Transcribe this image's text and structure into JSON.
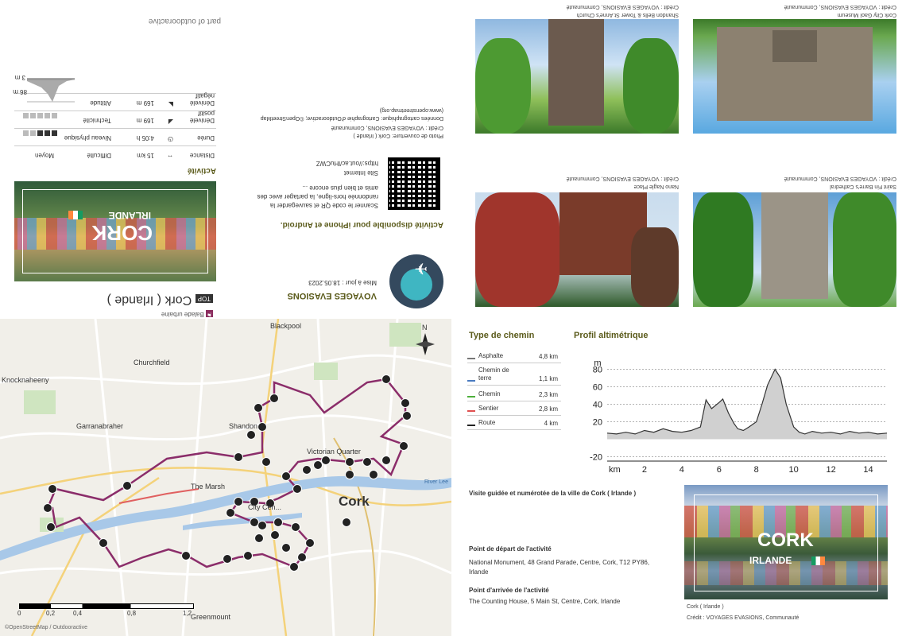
{
  "header": {
    "brand": "part of outdooractive",
    "category": "Balade urbaine",
    "top_badge": "TOP",
    "title": "Cork ( Irlande )"
  },
  "cover_card": {
    "city": "CORK",
    "country": "IRLANDE"
  },
  "activity_table": {
    "heading": "Activité",
    "rows": [
      {
        "label": "Distance",
        "icon": "distance-icon",
        "value": "15 km",
        "extra_label": "Difficulté",
        "extra_value": "Moyen"
      },
      {
        "label": "Durée",
        "icon": "clock-icon",
        "value": "4:05 h",
        "extra_label": "Niveau physique",
        "extra_value": ""
      },
      {
        "label": "Dénivelé positif",
        "icon": "ascent-icon",
        "value": "169 m",
        "extra_label": "Technicité",
        "extra_value": ""
      },
      {
        "label": "Dénivelé négatif",
        "icon": "descent-icon",
        "value": "169 m",
        "extra_label": "Altitude",
        "extra_value": ""
      }
    ],
    "physical_level": 3,
    "technical_level": 0,
    "level_max": 5,
    "altitude_max": "86 m",
    "altitude_min": "3 m"
  },
  "publisher": {
    "name": "VOYAGES EVASIONS",
    "updated": "Mise à jour : 18.05.2023",
    "app_title": "Activité disponible pour iPhone et Android.",
    "app_text": "Scanner le code QR et sauvegarder la randonnée hors-ligne, la partager avec des amis et bien plus encore ...",
    "site_label": "Site Internet",
    "site_url": "https://out.ac/lHuCWZ",
    "photo_credit": "Photo de couverture: Cork ( Irlande )",
    "photo_credit2": "Crédit : VOYAGES EVASIONS, Communauté",
    "map_data": "Données cartographique: Cartographie d'Outdooractive; ©OpenStreetMap",
    "map_url": "(www.openstreetmap.org)"
  },
  "photos": [
    {
      "title": "Shandon Bells & Tower St.Anne's Church",
      "credit": "Crédit : VOYAGES EVASIONS, Communauté"
    },
    {
      "title": "Cork City Gaol Museum",
      "credit": "Crédit : VOYAGES EVASIONS, Communauté"
    },
    {
      "title": "Nano Nagle Place",
      "credit": "Crédit : VOYAGES EVASIONS, Communauté"
    },
    {
      "title": "Saint Fin Barre's Cathedral",
      "credit": "Crédit : VOYAGES EVASIONS, Communauté"
    }
  ],
  "map": {
    "labels": [
      "Blackpool",
      "Churchfield",
      "Knocknaheeny",
      "Garranabraher",
      "Shandon",
      "Victorian Quarter",
      "The Marsh",
      "City Cen...",
      "Cork",
      "Greenmount",
      "River Lee"
    ],
    "scale": [
      "0",
      "0,2",
      "0,4",
      "0,8",
      "1,2"
    ],
    "copyright": "©OpenStreetMap / Outdooractive",
    "north": "N"
  },
  "legend": {
    "title": "Type de chemin",
    "rows": [
      {
        "name": "Asphalte",
        "value": "4,8 km",
        "color": "#777777"
      },
      {
        "name": "Chemin de terre",
        "value": "1,1 km",
        "color": "#4a7bc0"
      },
      {
        "name": "Chemin",
        "value": "2,3 km",
        "color": "#4caf3a"
      },
      {
        "name": "Sentier",
        "value": "2,8 km",
        "color": "#e05050"
      },
      {
        "name": "Route",
        "value": "4 km",
        "color": "#222222"
      }
    ]
  },
  "chart_data": {
    "type": "area",
    "title": "Profil altimétrique",
    "xlabel": "km",
    "ylabel": "m",
    "x": [
      0,
      0.5,
      1,
      1.5,
      2,
      2.5,
      3,
      3.5,
      4,
      4.5,
      5,
      5.3,
      5.6,
      6,
      6.2,
      6.5,
      6.8,
      7,
      7.3,
      7.6,
      8,
      8.3,
      8.6,
      9,
      9.3,
      9.6,
      10,
      10.3,
      10.6,
      11,
      11.5,
      12,
      12.5,
      13,
      13.5,
      14,
      14.5,
      15
    ],
    "y": [
      7,
      6,
      8,
      6,
      10,
      8,
      12,
      9,
      8,
      10,
      14,
      45,
      35,
      42,
      46,
      30,
      18,
      12,
      10,
      14,
      20,
      40,
      62,
      80,
      70,
      40,
      14,
      8,
      6,
      9,
      7,
      8,
      6,
      9,
      7,
      8,
      6,
      7
    ],
    "xticks": [
      2,
      4,
      6,
      8,
      10,
      12,
      14
    ],
    "yticks": [
      -20,
      20,
      40,
      60,
      80
    ],
    "xlim": [
      0,
      15
    ],
    "ylim": [
      -25,
      95
    ],
    "grid": true
  },
  "start_card": {
    "guided_title": "Visite guidée et numérotée de la ville de Cork ( Irlande )",
    "start_label": "Point de départ de l'activité",
    "start_value": "National Monument, 48 Grand Parade, Centre, Cork, T12 PY86, Irlande",
    "end_label": "Point d'arrivée de l'activité",
    "end_value": "The Counting House, 5 Main St, Centre, Cork, Irlande"
  },
  "cover_photo": {
    "city": "CORK",
    "country": "IRLANDE",
    "caption": "Cork ( Irlande )",
    "credit": "Crédit : VOYAGES EVASIONS, Communauté"
  }
}
